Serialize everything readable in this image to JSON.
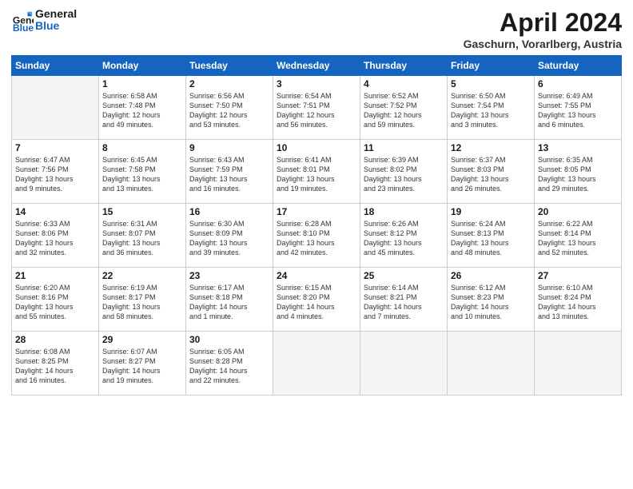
{
  "logo": {
    "line1": "General",
    "line2": "Blue"
  },
  "title": "April 2024",
  "location": "Gaschurn, Vorarlberg, Austria",
  "weekdays": [
    "Sunday",
    "Monday",
    "Tuesday",
    "Wednesday",
    "Thursday",
    "Friday",
    "Saturday"
  ],
  "weeks": [
    [
      {
        "day": "",
        "info": ""
      },
      {
        "day": "1",
        "info": "Sunrise: 6:58 AM\nSunset: 7:48 PM\nDaylight: 12 hours\nand 49 minutes."
      },
      {
        "day": "2",
        "info": "Sunrise: 6:56 AM\nSunset: 7:50 PM\nDaylight: 12 hours\nand 53 minutes."
      },
      {
        "day": "3",
        "info": "Sunrise: 6:54 AM\nSunset: 7:51 PM\nDaylight: 12 hours\nand 56 minutes."
      },
      {
        "day": "4",
        "info": "Sunrise: 6:52 AM\nSunset: 7:52 PM\nDaylight: 12 hours\nand 59 minutes."
      },
      {
        "day": "5",
        "info": "Sunrise: 6:50 AM\nSunset: 7:54 PM\nDaylight: 13 hours\nand 3 minutes."
      },
      {
        "day": "6",
        "info": "Sunrise: 6:49 AM\nSunset: 7:55 PM\nDaylight: 13 hours\nand 6 minutes."
      }
    ],
    [
      {
        "day": "7",
        "info": "Sunrise: 6:47 AM\nSunset: 7:56 PM\nDaylight: 13 hours\nand 9 minutes."
      },
      {
        "day": "8",
        "info": "Sunrise: 6:45 AM\nSunset: 7:58 PM\nDaylight: 13 hours\nand 13 minutes."
      },
      {
        "day": "9",
        "info": "Sunrise: 6:43 AM\nSunset: 7:59 PM\nDaylight: 13 hours\nand 16 minutes."
      },
      {
        "day": "10",
        "info": "Sunrise: 6:41 AM\nSunset: 8:01 PM\nDaylight: 13 hours\nand 19 minutes."
      },
      {
        "day": "11",
        "info": "Sunrise: 6:39 AM\nSunset: 8:02 PM\nDaylight: 13 hours\nand 23 minutes."
      },
      {
        "day": "12",
        "info": "Sunrise: 6:37 AM\nSunset: 8:03 PM\nDaylight: 13 hours\nand 26 minutes."
      },
      {
        "day": "13",
        "info": "Sunrise: 6:35 AM\nSunset: 8:05 PM\nDaylight: 13 hours\nand 29 minutes."
      }
    ],
    [
      {
        "day": "14",
        "info": "Sunrise: 6:33 AM\nSunset: 8:06 PM\nDaylight: 13 hours\nand 32 minutes."
      },
      {
        "day": "15",
        "info": "Sunrise: 6:31 AM\nSunset: 8:07 PM\nDaylight: 13 hours\nand 36 minutes."
      },
      {
        "day": "16",
        "info": "Sunrise: 6:30 AM\nSunset: 8:09 PM\nDaylight: 13 hours\nand 39 minutes."
      },
      {
        "day": "17",
        "info": "Sunrise: 6:28 AM\nSunset: 8:10 PM\nDaylight: 13 hours\nand 42 minutes."
      },
      {
        "day": "18",
        "info": "Sunrise: 6:26 AM\nSunset: 8:12 PM\nDaylight: 13 hours\nand 45 minutes."
      },
      {
        "day": "19",
        "info": "Sunrise: 6:24 AM\nSunset: 8:13 PM\nDaylight: 13 hours\nand 48 minutes."
      },
      {
        "day": "20",
        "info": "Sunrise: 6:22 AM\nSunset: 8:14 PM\nDaylight: 13 hours\nand 52 minutes."
      }
    ],
    [
      {
        "day": "21",
        "info": "Sunrise: 6:20 AM\nSunset: 8:16 PM\nDaylight: 13 hours\nand 55 minutes."
      },
      {
        "day": "22",
        "info": "Sunrise: 6:19 AM\nSunset: 8:17 PM\nDaylight: 13 hours\nand 58 minutes."
      },
      {
        "day": "23",
        "info": "Sunrise: 6:17 AM\nSunset: 8:18 PM\nDaylight: 14 hours\nand 1 minute."
      },
      {
        "day": "24",
        "info": "Sunrise: 6:15 AM\nSunset: 8:20 PM\nDaylight: 14 hours\nand 4 minutes."
      },
      {
        "day": "25",
        "info": "Sunrise: 6:14 AM\nSunset: 8:21 PM\nDaylight: 14 hours\nand 7 minutes."
      },
      {
        "day": "26",
        "info": "Sunrise: 6:12 AM\nSunset: 8:23 PM\nDaylight: 14 hours\nand 10 minutes."
      },
      {
        "day": "27",
        "info": "Sunrise: 6:10 AM\nSunset: 8:24 PM\nDaylight: 14 hours\nand 13 minutes."
      }
    ],
    [
      {
        "day": "28",
        "info": "Sunrise: 6:08 AM\nSunset: 8:25 PM\nDaylight: 14 hours\nand 16 minutes."
      },
      {
        "day": "29",
        "info": "Sunrise: 6:07 AM\nSunset: 8:27 PM\nDaylight: 14 hours\nand 19 minutes."
      },
      {
        "day": "30",
        "info": "Sunrise: 6:05 AM\nSunset: 8:28 PM\nDaylight: 14 hours\nand 22 minutes."
      },
      {
        "day": "",
        "info": ""
      },
      {
        "day": "",
        "info": ""
      },
      {
        "day": "",
        "info": ""
      },
      {
        "day": "",
        "info": ""
      }
    ]
  ]
}
